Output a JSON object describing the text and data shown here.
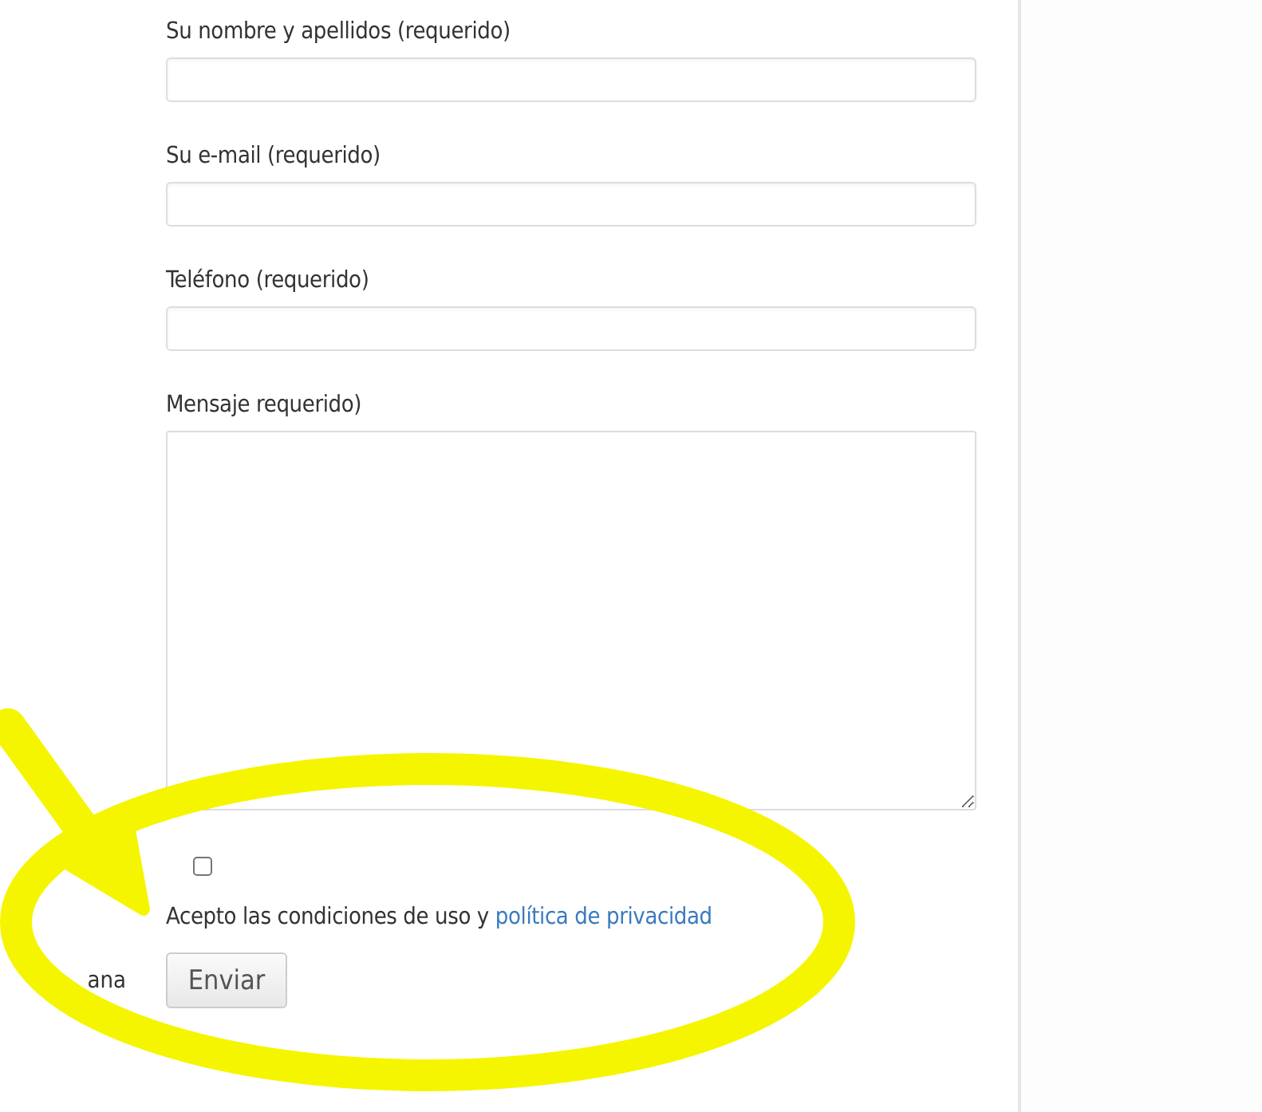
{
  "form": {
    "fields": [
      {
        "label": "Su nombre y apellidos (requerido)",
        "kind": "input"
      },
      {
        "label": "Su e-mail (requerido)",
        "kind": "input"
      },
      {
        "label": "Teléfono (requerido)",
        "kind": "input"
      },
      {
        "label": "Mensaje requerido)",
        "kind": "textarea"
      }
    ],
    "consent": {
      "checked": false,
      "text": "Acepto las condiciones de uso y",
      "link": "política de privacidad"
    },
    "side_text": "ana",
    "submit": "Enviar"
  }
}
